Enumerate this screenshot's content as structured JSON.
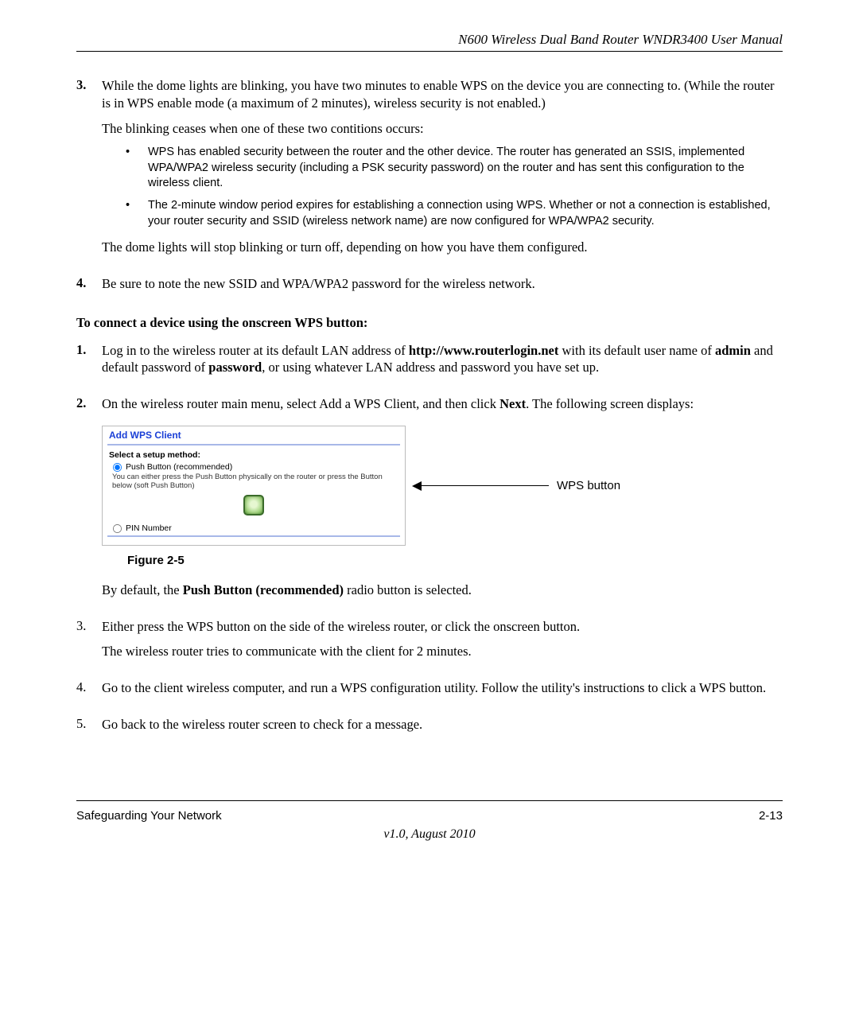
{
  "header": {
    "running_title": "N600 Wireless Dual Band Router WNDR3400 User Manual"
  },
  "body": {
    "steps_a": [
      {
        "num": "3.",
        "paras": [
          "While the dome lights are blinking, you have two minutes to enable WPS on the device you are connecting to. (While the router is in WPS enable mode (a maximum of 2 minutes), wireless security is not enabled.)",
          "The blinking ceases when one of these two contitions occurs:"
        ],
        "bullets": [
          "WPS has enabled security between the router and the other device. The router has generated an SSIS, implemented WPA/WPA2 wireless security (including a PSK security password) on the router and has sent this configuration to the wireless client.",
          "The 2-minute window period expires for establishing a connection using WPS. Whether or not a connection is established, your router security and SSID (wireless network name) are now configured for WPA/WPA2 security."
        ],
        "tail": "The dome lights will stop blinking or turn off, depending on how you have them configured."
      },
      {
        "num": "4.",
        "paras": [
          "Be sure to note the new SSID and WPA/WPA2 password for the wireless network."
        ]
      }
    ],
    "subheading": "To connect a device using the onscreen WPS button:",
    "steps_b": {
      "s1": {
        "num": "1.",
        "t1": "Log in to the wireless router at its default LAN address of ",
        "url": "http://www.routerlogin.net",
        "t2": " with its default user name of ",
        "admin": "admin",
        "t3": " and default password of ",
        "password": "password",
        "t4": ", or using whatever LAN address and password you have set up."
      },
      "s2": {
        "num": "2.",
        "t1": "On the wireless router main menu, select Add a WPS Client, and then click ",
        "next": "Next",
        "t2": ". The following screen displays:"
      }
    },
    "figure": {
      "title": "Add WPS Client",
      "select_label": "Select a setup method:",
      "opt_push": "Push Button (recommended)",
      "push_note": "You can either press the Push Button physically on the router or press the Button below (soft Push Button)",
      "opt_pin": "PIN Number",
      "callout": "WPS button",
      "caption": "Figure 2-5"
    },
    "after_figure": {
      "def_1": "By default, the ",
      "def_bold": "Push Button (recommended)",
      "def_2": " radio button is selected."
    },
    "steps_c": [
      {
        "num": "3.",
        "paras": [
          "Either press the WPS button on the side of the wireless router, or click the onscreen button.",
          "The wireless router tries to communicate with the client for 2 minutes."
        ]
      },
      {
        "num": "4.",
        "paras": [
          "Go to the client wireless computer, and run a WPS configuration utility. Follow the utility's instructions to click a WPS button."
        ]
      },
      {
        "num": "5.",
        "paras": [
          "Go back to the wireless router screen to check for a message."
        ]
      }
    ]
  },
  "footer": {
    "left": "Safeguarding Your Network",
    "right": "2-13",
    "version": "v1.0, August 2010"
  }
}
